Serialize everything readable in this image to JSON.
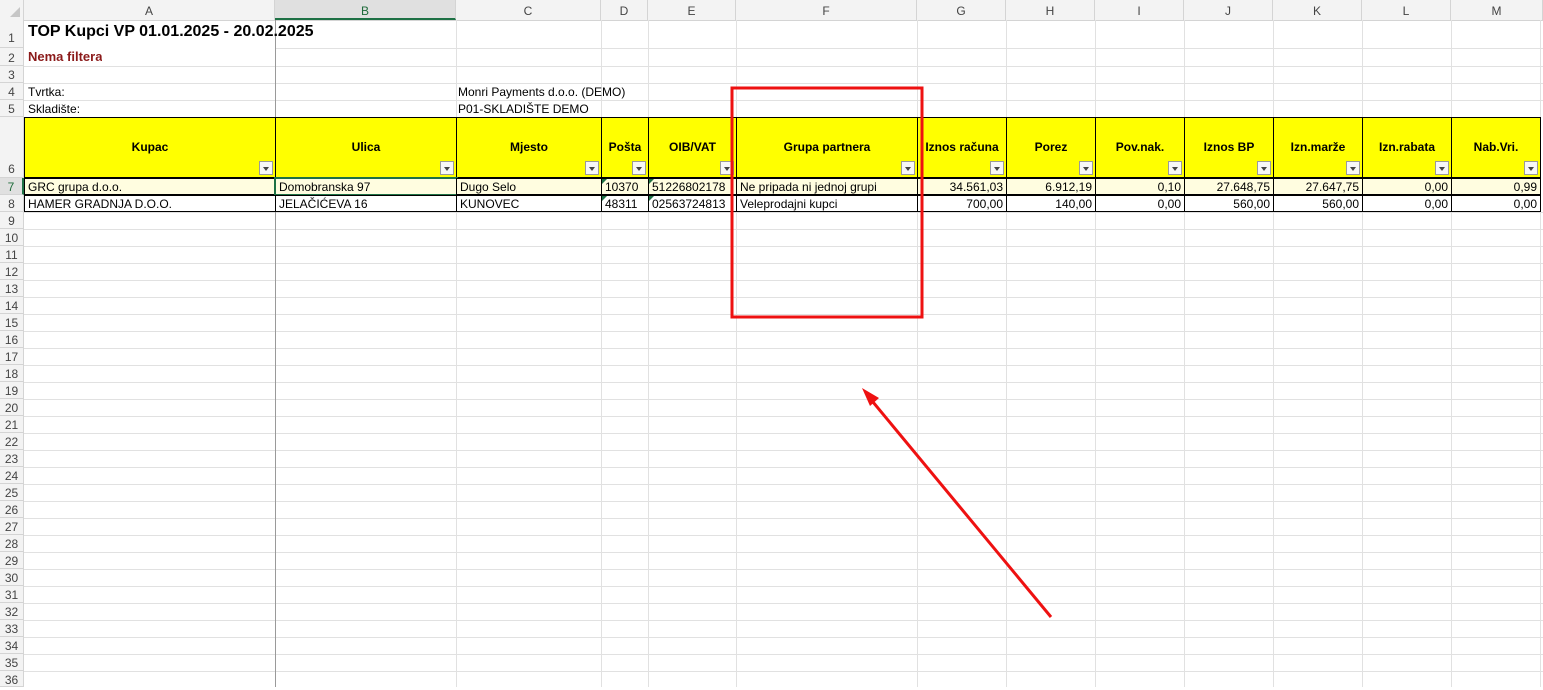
{
  "columns": [
    "A",
    "B",
    "C",
    "D",
    "E",
    "F",
    "G",
    "H",
    "I",
    "J",
    "K",
    "L",
    "M"
  ],
  "selected_column": "B",
  "rows": [
    "1",
    "2",
    "3",
    "4",
    "5",
    "6",
    "7",
    "8",
    "9",
    "10",
    "11",
    "12",
    "13",
    "14",
    "15",
    "16",
    "17",
    "18",
    "19",
    "20",
    "21",
    "22",
    "23",
    "24",
    "25",
    "26",
    "27",
    "28",
    "29",
    "30",
    "31",
    "32",
    "33",
    "34",
    "35",
    "36"
  ],
  "report": {
    "title": "TOP Kupci VP 01.01.2025 - 20.02.2025",
    "filter_note": "Nema filtera",
    "company_label": "Tvrtka:",
    "company_value": "Monri Payments d.o.o. (DEMO)",
    "warehouse_label": "Skladište:",
    "warehouse_value": "P01-SKLADIŠTE DEMO"
  },
  "table": {
    "headers": [
      "Kupac",
      "Ulica",
      "Mjesto",
      "Pošta",
      "OIB/VAT",
      "Grupa partnera",
      "Iznos računa",
      "Porez",
      "Pov.nak.",
      "Iznos BP",
      "Izn.marže",
      "Izn.rabata",
      "Nab.Vri."
    ],
    "rows": [
      [
        "GRC grupa d.o.o.",
        "Domobranska 97",
        "Dugo Selo",
        "10370",
        "51226802178",
        "Ne pripada ni jednoj grupi",
        "34.561,03",
        "6.912,19",
        "0,10",
        "27.648,75",
        "27.647,75",
        "0,00",
        "0,99"
      ],
      [
        "HAMER GRADNJA D.O.O.",
        "JELAČIĆEVA 16",
        "KUNOVEC",
        "48311",
        "02563724813",
        "Veleprodajni kupci",
        "700,00",
        "140,00",
        "0,00",
        "560,00",
        "560,00",
        "0,00",
        "0,00"
      ]
    ]
  },
  "colors": {
    "header_fill": "#ffff00",
    "annotation": "#ff0000",
    "selection": "#1e7145"
  }
}
